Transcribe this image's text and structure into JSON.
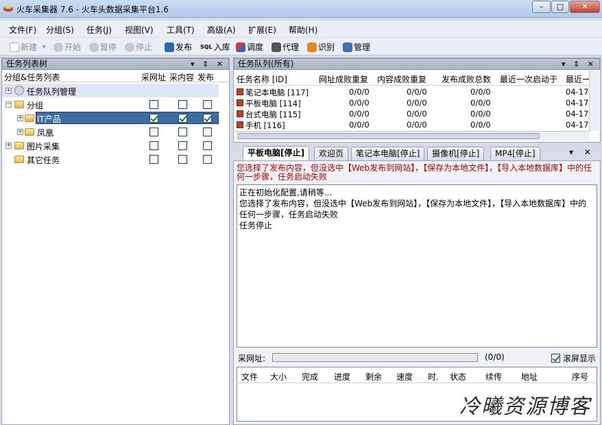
{
  "window": {
    "title": "火车采集器 7.6 - 火车头数据采集平台1.6",
    "min": "–",
    "max": "□",
    "close": "✕"
  },
  "menu": [
    "文件(F)",
    "分组(S)",
    "任务(J)",
    "视图(V)",
    "工具(T)",
    "高级(A)",
    "扩展(E)",
    "帮助(H)"
  ],
  "toolbar": {
    "new": "新建",
    "start": "开始",
    "pause": "暂停",
    "stop": "停止",
    "publish": "发布",
    "import": "入库",
    "debug": "调度",
    "proxy": "代理",
    "ocr": "识别",
    "manage": "管理",
    "sql_badge": "SQL"
  },
  "left": {
    "header": "任务列表树",
    "col_tree": "分组&任务列表",
    "col_url": "采网址",
    "col_content": "采内容",
    "col_publish": "发布",
    "panel_btns": "▾ ⇕ ✕",
    "rows": [
      {
        "label": "任务队列管理"
      },
      {
        "label": "分组"
      },
      {
        "label": "IT产品"
      },
      {
        "label": "凤凰"
      },
      {
        "label": "图片采集"
      },
      {
        "label": "其它任务"
      }
    ]
  },
  "queue": {
    "header": "任务队列(所有)",
    "panel_btns": "▾ ⇕ ✕",
    "cols": [
      "任务名称 [ID]",
      "网址成败重复",
      "内容成败重复",
      "发布成败总数",
      "最近一次启动于",
      "最近一"
    ],
    "rows": [
      {
        "name": "笔记本电脑 [117]",
        "url": "0/0/0",
        "content": "0/0/0",
        "publish": "0/0/0",
        "last": "",
        "last2": "04-17"
      },
      {
        "name": "平板电脑 [114]",
        "url": "0/0/0",
        "content": "0/0/0",
        "publish": "0/0/0",
        "last": "",
        "last2": "04-17"
      },
      {
        "name": "台式电脑 [115]",
        "url": "0/0/0",
        "content": "0/0/0",
        "publish": "0/0/0",
        "last": "",
        "last2": "04-17"
      },
      {
        "name": "手机 [116]",
        "url": "0/0/0",
        "content": "0/0/0",
        "publish": "0/0/0",
        "last": "",
        "last2": "04-17"
      }
    ]
  },
  "tabs": [
    "平板电脑[停止]",
    "欢迎页",
    "笔记本电脑[停止]",
    "摄像机[停止]",
    "MP4[停止]"
  ],
  "tab_btns": "▾ ✕",
  "warning": "您选择了发布内容，但没选中【Web发布到网站】，【保存为本地文件】，【导入本地数据库】中的任何一步骤，任务启动失败",
  "log": "正在初始化配置,请稍等...\n您选择了发布内容，但没选中【Web发布到网站】，【保存为本地文件】，【导入本地数据库】中的任何一步骤，任务启动失败\n任务停止",
  "progress": {
    "label": "采网址:",
    "count": "(0/0)",
    "scroll_label": "滚屏显示",
    "value": 0
  },
  "download": {
    "cols": [
      "文件",
      "大小",
      "完成",
      "进度",
      "剩余",
      "速度",
      "时.",
      "状态",
      "续传",
      "地址",
      "序号"
    ]
  },
  "watermark": "冷曦资源博客"
}
